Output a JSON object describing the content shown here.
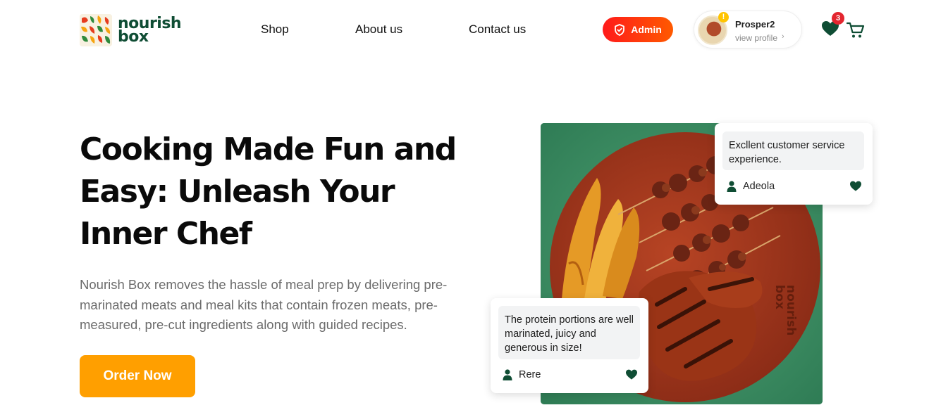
{
  "brand": {
    "line1": "nourish",
    "line2": "box"
  },
  "nav": {
    "shop": "Shop",
    "about": "About us",
    "contact": "Contact us"
  },
  "admin": {
    "label": "Admin"
  },
  "profile": {
    "name": "Prosper2",
    "sub": "view profile",
    "alert": "!"
  },
  "favorites": {
    "count": "3"
  },
  "hero": {
    "title": "Cooking Made Fun and Easy: Unleash Your Inner Chef",
    "description": "Nourish Box removes the hassle of meal prep by delivering pre-marinated meats and meal kits that contain frozen meats, pre-measured, pre-cut ingredients along with guided recipes.",
    "cta": "Order Now"
  },
  "image": {
    "board_line1": "nourish",
    "board_line2": "box"
  },
  "reviews": [
    {
      "quote": "Excllent customer service experience.",
      "author": "Adeola"
    },
    {
      "quote": "The protein portions are well marinated, juicy and generous in size!",
      "author": "Rere"
    }
  ],
  "colors": {
    "brand_green": "#0f4d34",
    "accent_orange": "#ff9f00",
    "admin_red": "#ff1a1a",
    "badge_red": "#e3262f"
  }
}
